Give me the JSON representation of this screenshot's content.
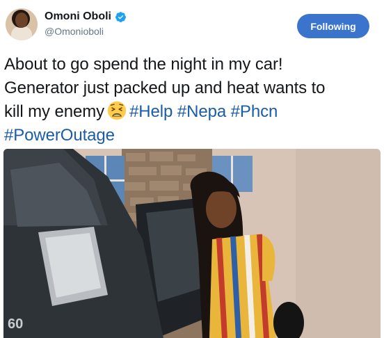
{
  "author": {
    "display_name": "Omoni Oboli",
    "handle": "@Omonioboli",
    "verified": true,
    "verified_icon": "verified-badge-icon",
    "avatar": "avatar"
  },
  "follow_button": {
    "label": "Following"
  },
  "tweet": {
    "text_parts": {
      "line_a": "About to go spend the night in my car!",
      "line_b": "Generator just packed up and heat wants to",
      "line_c": "kill my enemy",
      "emoji_name": "weary-face-emoji",
      "hashtags": [
        "#Help",
        "#Nepa",
        "#Phcn",
        "#PowerOutage"
      ]
    }
  },
  "media": {
    "type": "photo",
    "car_badge": "60"
  },
  "colors": {
    "accent": "#3b74cc",
    "hashtag": "#1b5ca8",
    "handle_gray": "#657786",
    "text": "#14171a"
  }
}
